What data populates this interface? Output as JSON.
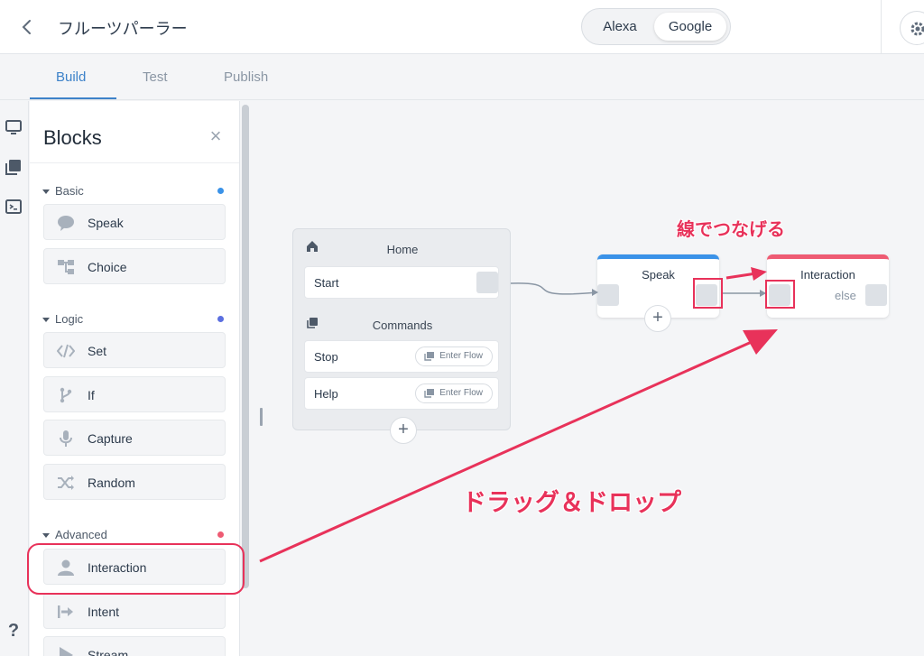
{
  "header": {
    "app_title": "フルーツパーラー",
    "platforms": [
      "Alexa",
      "Google"
    ],
    "selected_platform": "Google"
  },
  "tabs": [
    {
      "label": "Build",
      "active": true
    },
    {
      "label": "Test",
      "active": false
    },
    {
      "label": "Publish",
      "active": false
    }
  ],
  "rail_icons": [
    "monitor-icon",
    "blocks-icon",
    "terminal-icon",
    "help-icon"
  ],
  "help_label": "?",
  "panel": {
    "title": "Blocks",
    "sections": [
      {
        "name": "Basic",
        "color": "#3a92e8",
        "items": [
          {
            "label": "Speak",
            "icon": "speech-bubble-icon"
          },
          {
            "label": "Choice",
            "icon": "choice-icon"
          }
        ]
      },
      {
        "name": "Logic",
        "color": "#5b6fe0",
        "items": [
          {
            "label": "Set",
            "icon": "code-icon"
          },
          {
            "label": "If",
            "icon": "branch-icon"
          },
          {
            "label": "Capture",
            "icon": "microphone-icon"
          },
          {
            "label": "Random",
            "icon": "shuffle-icon"
          }
        ]
      },
      {
        "name": "Advanced",
        "color": "#ee5b73",
        "items": [
          {
            "label": "Interaction",
            "icon": "person-icon"
          },
          {
            "label": "Intent",
            "icon": "intent-arrow-icon"
          },
          {
            "label": "Stream",
            "icon": "play-icon"
          }
        ]
      }
    ]
  },
  "canvas": {
    "home_block": {
      "title": "Home",
      "start_label": "Start",
      "commands_title": "Commands",
      "commands": [
        {
          "label": "Stop",
          "action": "Enter Flow"
        },
        {
          "label": "Help",
          "action": "Enter Flow"
        }
      ]
    },
    "speak_node": {
      "title": "Speak",
      "color": "#3a92e8"
    },
    "interaction_node": {
      "title": "Interaction",
      "else_label": "else",
      "color": "#ee5b73"
    },
    "plus_label": "+"
  },
  "annotations": {
    "connect_label": "線でつなげる",
    "drag_label": "ドラッグ＆ドロップ",
    "color": "#e8325a"
  }
}
